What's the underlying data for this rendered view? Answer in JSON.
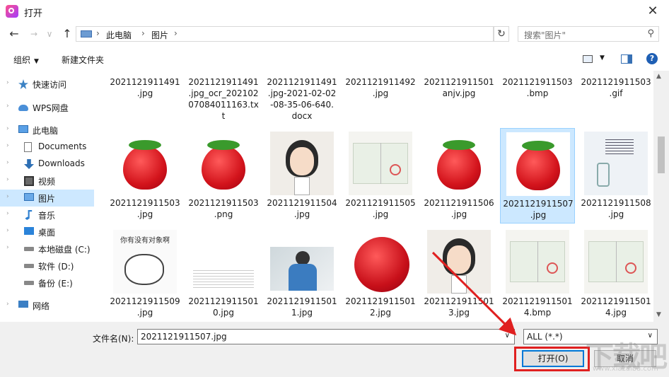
{
  "window": {
    "title": "打开",
    "close": "✕"
  },
  "address": {
    "crumbs": [
      "此电脑",
      "图片"
    ],
    "search_placeholder": "搜索\"图片\""
  },
  "toolbar": {
    "organize": "组织",
    "new_folder": "新建文件夹",
    "help": "?"
  },
  "nav": [
    {
      "label": "快速访问",
      "icon": "star-icon"
    },
    {
      "label": "WPS网盘",
      "icon": "cloud-icon"
    },
    {
      "label": "此电脑",
      "icon": "computer-icon"
    },
    {
      "label": "Documents",
      "icon": "document-icon"
    },
    {
      "label": "Downloads",
      "icon": "download-icon"
    },
    {
      "label": "视频",
      "icon": "video-icon"
    },
    {
      "label": "图片",
      "icon": "picture-icon"
    },
    {
      "label": "音乐",
      "icon": "music-icon"
    },
    {
      "label": "桌面",
      "icon": "desktop-icon"
    },
    {
      "label": "本地磁盘 (C:)",
      "icon": "drive-icon"
    },
    {
      "label": "软件 (D:)",
      "icon": "drive-icon"
    },
    {
      "label": "备份 (E:)",
      "icon": "drive-icon"
    },
    {
      "label": "网络",
      "icon": "network-icon"
    }
  ],
  "files": [
    {
      "name": "2021121911491\n.jpg",
      "thumb": "blank"
    },
    {
      "name": "2021121911491\n.jpg_ocr_202102\n07084011163.tx\nt",
      "thumb": "blank"
    },
    {
      "name": "2021121911491\n.jpg-2021-02-02\n-08-35-06-640.\ndocx",
      "thumb": "blank"
    },
    {
      "name": "2021121911492\n.jpg",
      "thumb": "blank"
    },
    {
      "name": "2021121911501\nanjv.jpg",
      "thumb": "blank"
    },
    {
      "name": "2021121911503\n.bmp",
      "thumb": "blank"
    },
    {
      "name": "2021121911503\n.gif",
      "thumb": "blank"
    },
    {
      "name": "2021121911503\n.jpg",
      "thumb": "strawberry"
    },
    {
      "name": "2021121911503\n.png",
      "thumb": "strawberry"
    },
    {
      "name": "2021121911504\n.jpg",
      "thumb": "cartoon"
    },
    {
      "name": "2021121911505\n.jpg",
      "thumb": "certificate"
    },
    {
      "name": "2021121911506\n.jpg",
      "thumb": "strawberry"
    },
    {
      "name": "2021121911507\n.jpg",
      "thumb": "strawberry",
      "selected": true
    },
    {
      "name": "2021121911508\n.jpg",
      "thumb": "poster"
    },
    {
      "name": "2021121911509\n.jpg",
      "thumb": "meme"
    },
    {
      "name": "2021121911501\n0.jpg",
      "thumb": "document"
    },
    {
      "name": "2021121911501\n1.jpg",
      "thumb": "photo"
    },
    {
      "name": "2021121911501\n2.jpg",
      "thumb": "strawberry-big"
    },
    {
      "name": "2021121911501\n3.jpg",
      "thumb": "cartoon"
    },
    {
      "name": "2021121911501\n4.bmp",
      "thumb": "certificate"
    },
    {
      "name": "2021121911501\n4.jpg",
      "thumb": "certificate"
    }
  ],
  "thumb_text": {
    "meme_caption": "你有没有对象啊"
  },
  "bottom": {
    "filename_label": "文件名(N):",
    "filename_value": "2021121911507.jpg",
    "filter_value": "ALL (*.*)",
    "open_label": "打开(O)",
    "cancel_label": "取消"
  },
  "colors": {
    "accent": "#0078d7",
    "annotation_red": "#e02020",
    "selection": "#cce8ff"
  }
}
